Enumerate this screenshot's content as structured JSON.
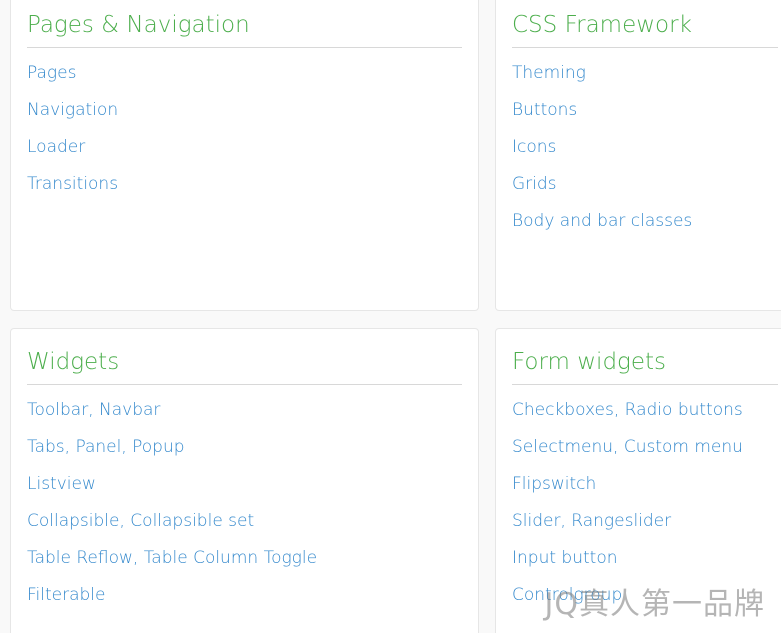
{
  "colors": {
    "title": "#4cae4c",
    "link": "#3388cc",
    "divider": "#d8d8d8"
  },
  "sections": [
    {
      "title": "Pages & Navigation",
      "links": [
        [
          "Pages"
        ],
        [
          "Navigation"
        ],
        [
          "Loader"
        ],
        [
          "Transitions"
        ]
      ]
    },
    {
      "title": "CSS Framework",
      "links": [
        [
          "Theming"
        ],
        [
          "Buttons"
        ],
        [
          "Icons"
        ],
        [
          "Grids"
        ],
        [
          "Body and bar classes"
        ]
      ]
    },
    {
      "title": "Widgets",
      "links": [
        [
          "Toolbar",
          "Navbar"
        ],
        [
          "Tabs",
          "Panel",
          "Popup"
        ],
        [
          "Listview"
        ],
        [
          "Collapsible",
          "Collapsible set"
        ],
        [
          "Table Reflow",
          "Table Column Toggle"
        ],
        [
          "Filterable"
        ]
      ]
    },
    {
      "title": "Form widgets",
      "links": [
        [
          "Checkboxes",
          "Radio buttons"
        ],
        [
          "Selectmenu",
          "Custom menu"
        ],
        [
          "Flipswitch"
        ],
        [
          "Slider",
          "Rangeslider"
        ],
        [
          "Input button"
        ],
        [
          "Controlgroup"
        ]
      ]
    }
  ],
  "watermark": "JQ真人第一品牌"
}
